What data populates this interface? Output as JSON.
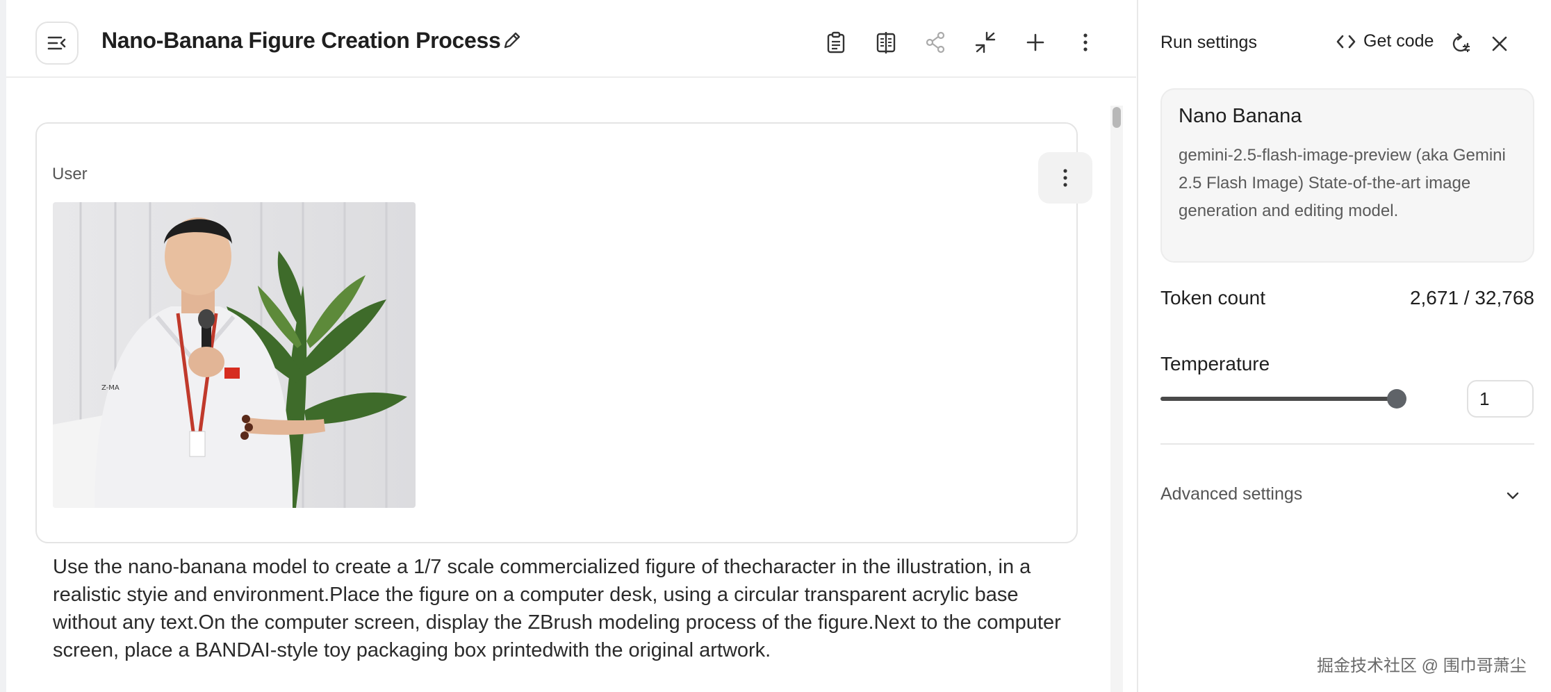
{
  "header": {
    "title": "Nano-Banana Figure Creation Process",
    "icons": [
      "sidebar-toggle-icon",
      "edit-pencil-icon",
      "clipboard-icon",
      "compare-icon",
      "share-icon",
      "collapse-icon",
      "add-icon",
      "more-vertical-icon"
    ]
  },
  "message": {
    "role": "User",
    "text": "Use the nano-banana model to create a 1/7 scale commercialized figure of thecharacter in the illustration, in a realistic styie and environment.Place the figure on a computer desk, using a circular transparent acrylic base without any text.On the computer screen, display the ZBrush modeling process of the figure.Next to the computer screen, place a BANDAI-style toy packaging box printedwith the original artwork."
  },
  "run_settings": {
    "title": "Run settings",
    "get_code": "Get code",
    "model": {
      "name": "Nano Banana",
      "description": "gemini-2.5-flash-image-preview (aka Gemini 2.5 Flash Image) State-of-the-art image generation and editing model."
    },
    "token_count_label": "Token count",
    "token_count_value": "2,671 / 32,768",
    "temperature_label": "Temperature",
    "temperature_value": "1",
    "temperature_level": 1,
    "advanced_label": "Advanced settings"
  },
  "watermark": "掘金技术社区 @ 围巾哥萧尘",
  "colors": {
    "slider": "#5f6368",
    "panel_bg": "#f6f6f6",
    "border": "#e4e4e4"
  }
}
